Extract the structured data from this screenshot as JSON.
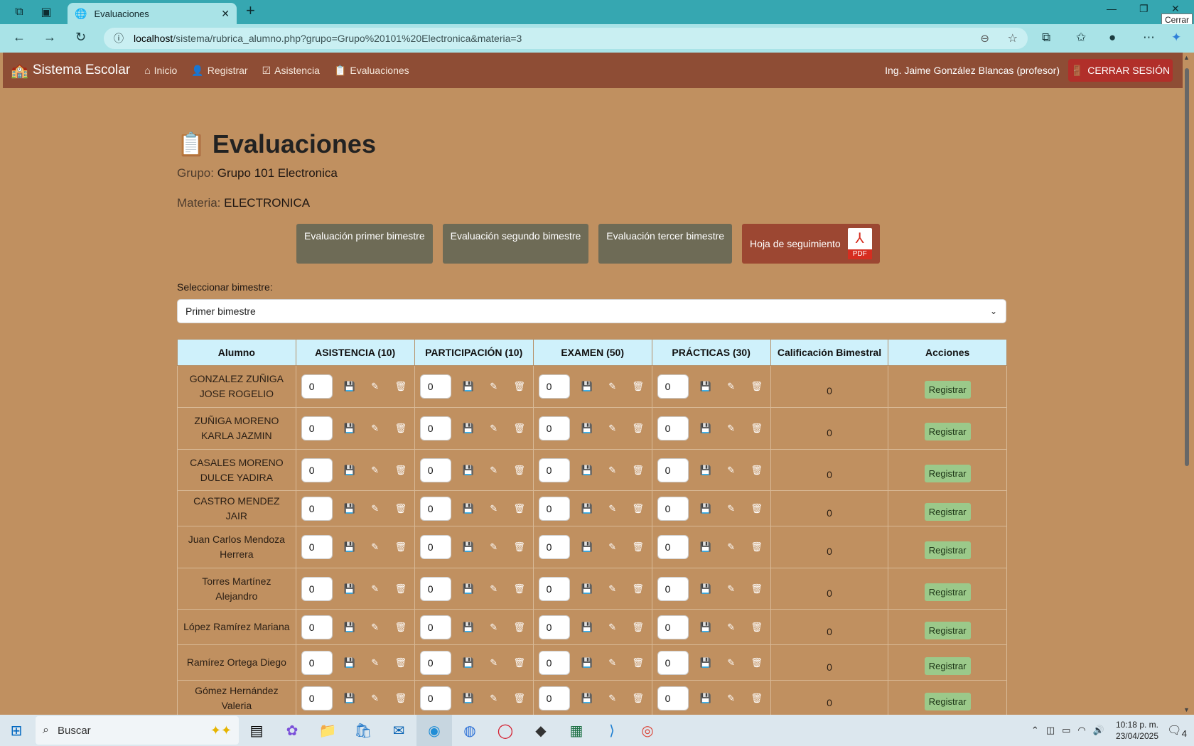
{
  "browser": {
    "tab_title": "Evaluaciones",
    "url_host": "localhost",
    "url_path": "/sistema/rubrica_alumno.php?grupo=Grupo%20101%20Electronica&materia=3",
    "tooltip": "Cerrar"
  },
  "navbar": {
    "brand": "Sistema Escolar",
    "links": [
      "Inicio",
      "Registrar",
      "Asistencia",
      "Evaluaciones"
    ],
    "user": "Ing. Jaime González Blancas (profesor)",
    "logout": "CERRAR SESIÓN"
  },
  "page": {
    "title": "Evaluaciones",
    "grupo_label": "Grupo:",
    "grupo_value": "Grupo 101 Electronica",
    "materia_label": "Materia:",
    "materia_value": "ELECTRONICA",
    "buttons": [
      "Evaluación primer bimestre",
      "Evaluación segundo bimestre",
      "Evaluación tercer bimestre"
    ],
    "pdf_button": "Hoja de seguimiento",
    "pdf_badge": "PDF",
    "select_label": "Seleccionar bimestre:",
    "select_value": "Primer bimestre"
  },
  "table": {
    "headers": [
      "Alumno",
      "ASISTENCIA (10)",
      "PARTICIPACIÓN (10)",
      "EXAMEN (50)",
      "PRÁCTICAS (30)",
      "Calificación Bimestral",
      "Acciones"
    ],
    "action_label": "Registrar",
    "rows": [
      {
        "name": "GONZALEZ ZUÑIGA JOSE ROGELIO",
        "asistencia": "0",
        "participacion": "0",
        "examen": "0",
        "practicas": "0",
        "calificacion": "0"
      },
      {
        "name": "ZUÑIGA MORENO KARLA JAZMIN",
        "asistencia": "0",
        "participacion": "0",
        "examen": "0",
        "practicas": "0",
        "calificacion": "0"
      },
      {
        "name": "CASALES MORENO DULCE YADIRA",
        "asistencia": "0",
        "participacion": "0",
        "examen": "0",
        "practicas": "0",
        "calificacion": "0"
      },
      {
        "name": "CASTRO MENDEZ JAIR",
        "asistencia": "0",
        "participacion": "0",
        "examen": "0",
        "practicas": "0",
        "calificacion": "0"
      },
      {
        "name": "Juan Carlos Mendoza Herrera",
        "asistencia": "0",
        "participacion": "0",
        "examen": "0",
        "practicas": "0",
        "calificacion": "0"
      },
      {
        "name": "Torres Martínez Alejandro",
        "asistencia": "0",
        "participacion": "0",
        "examen": "0",
        "practicas": "0",
        "calificacion": "0"
      },
      {
        "name": "López Ramírez Mariana",
        "asistencia": "0",
        "participacion": "0",
        "examen": "0",
        "practicas": "0",
        "calificacion": "0"
      },
      {
        "name": "Ramírez Ortega Diego",
        "asistencia": "0",
        "participacion": "0",
        "examen": "0",
        "practicas": "0",
        "calificacion": "0"
      },
      {
        "name": "Gómez Hernández Valeria",
        "asistencia": "0",
        "participacion": "0",
        "examen": "0",
        "practicas": "0",
        "calificacion": "0"
      }
    ]
  },
  "taskbar": {
    "search_placeholder": "Buscar",
    "time": "10:18 p. m.",
    "date": "23/04/2025",
    "notifications": "4"
  }
}
